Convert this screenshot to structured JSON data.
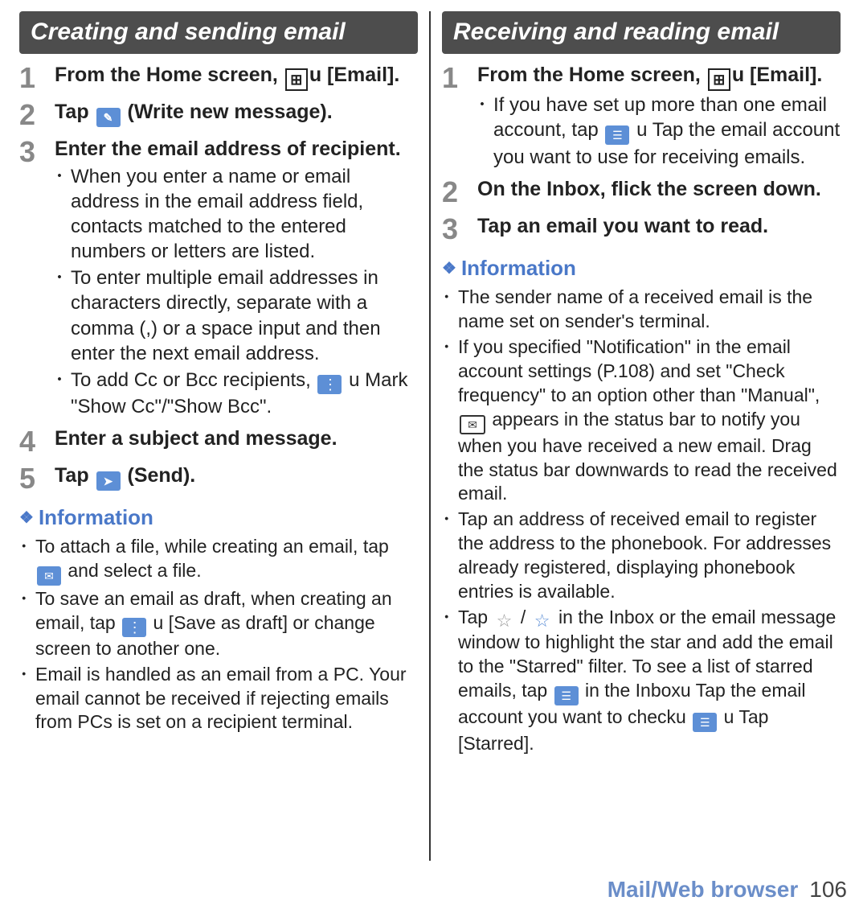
{
  "left": {
    "header": "Creating and sending email",
    "steps": [
      {
        "num": "1",
        "title_pre": "From the Home screen, ",
        "title_post": "u [Email].",
        "icon": "grid"
      },
      {
        "num": "2",
        "title_pre": "Tap ",
        "title_post": " (Write new message).",
        "icon": "compose"
      },
      {
        "num": "3",
        "title": "Enter the email address of recipient.",
        "subs": [
          "When you enter a name or email address in the email address field, contacts matched to the entered numbers or letters are listed.",
          "To enter multiple email addresses in characters directly, separate with a comma (,) or a space input and then enter the next email address.",
          "To add Cc or Bcc recipients, "
        ],
        "sub3_icon": "dots",
        "sub3_post": "u Mark \"Show Cc\"/\"Show Bcc\"."
      },
      {
        "num": "4",
        "title": "Enter a subject and message."
      },
      {
        "num": "5",
        "title_pre": "Tap ",
        "title_post": " (Send).",
        "icon": "send"
      }
    ],
    "info_title": "Information",
    "info": [
      {
        "pre": "To attach a file, while creating an email, tap ",
        "icon": "attach",
        "post": " and select a file."
      },
      {
        "pre": "To save an email as draft, when creating an email, tap ",
        "icon": "dots",
        "post": "u [Save as draft] or change screen to another one."
      },
      {
        "text": "Email is handled as an email from a PC. Your email cannot be received if rejecting emails from PCs is set on a recipient terminal."
      }
    ]
  },
  "right": {
    "header": "Receiving and reading email",
    "steps": [
      {
        "num": "1",
        "title_pre": "From the Home screen, ",
        "title_post": "u [Email].",
        "icon": "grid",
        "sub_pre": "If you have set up more than one email account, tap ",
        "sub_icon": "menu",
        "sub_post": "u Tap the email account you want to use for receiving emails."
      },
      {
        "num": "2",
        "title": "On the Inbox, flick the screen down."
      },
      {
        "num": "3",
        "title": "Tap an email you want to read."
      }
    ],
    "info_title": "Information",
    "info": [
      {
        "text": "The sender name of a received email is the name set on sender's terminal."
      },
      {
        "pre": "If you specified \"Notification\" in the email account settings (P.108) and set \"Check frequency\" to an option other than \"Manual\", ",
        "icon": "envelope-outline",
        "post": " appears in the status bar to notify you when you have received a new email. Drag the status bar downwards to read the received email."
      },
      {
        "text": "Tap an address of received email to register the address to the phonebook. For addresses already registered, displaying phonebook entries is available."
      },
      {
        "pre": "Tap  ",
        "icon": "star-outline",
        "mid": " / ",
        "icon2": "star-outline",
        "post": " in the Inbox or the email message window to highlight the star and add the email to the \"Starred\" filter. To see a list of starred emails, tap ",
        "icon3": "menu",
        "post2": " in the Inboxu Tap the email account you want to checku ",
        "icon4": "menu",
        "post3": "u Tap [Starred]."
      }
    ]
  },
  "footer": {
    "section": "Mail/Web browser",
    "page": "106"
  },
  "bullet": "･",
  "diamond": "❖"
}
